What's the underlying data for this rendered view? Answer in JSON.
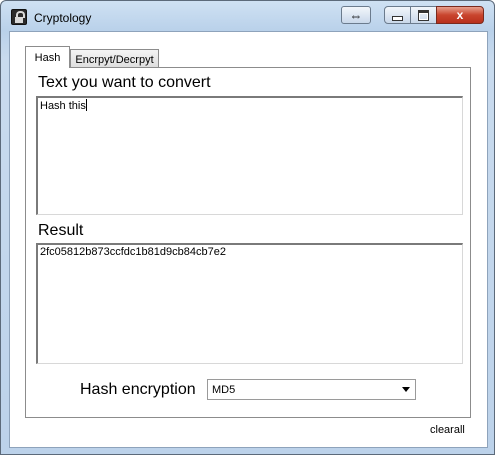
{
  "window": {
    "title": "Cryptology",
    "close_glyph": "x",
    "snap_glyph": "⇔"
  },
  "tabs": [
    {
      "label": "Hash",
      "selected": true
    },
    {
      "label": "Encrpyt/Decrpyt",
      "selected": false
    }
  ],
  "hash_tab": {
    "input_label": "Text you want to convert",
    "input_value": "Hash this",
    "result_label": "Result",
    "result_value": "2fc05812b873ccfdc1b81d9cb84cb7e2",
    "algorithm_label": "Hash encryption",
    "algorithm_value": "MD5"
  },
  "footer": {
    "clear_label": "clearall"
  },
  "colors": {
    "title_gradient_top": "#cfe1f3",
    "close_button": "#c9452e"
  },
  "icons": [
    "lock-icon",
    "snap-icon",
    "minimize-icon",
    "maximize-icon",
    "close-icon",
    "dropdown-arrow-icon"
  ]
}
